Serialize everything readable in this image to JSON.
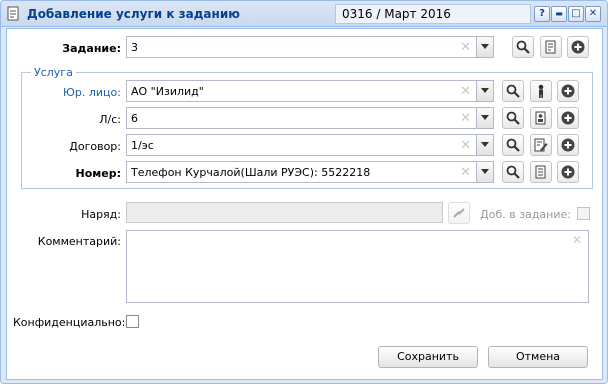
{
  "window": {
    "title": "Добавление услуги к заданию",
    "period": "0316 / Март 2016",
    "buttons": {
      "help": "?",
      "minimize": "▬",
      "maximize": "□",
      "close": "✕"
    }
  },
  "task": {
    "label": "Задание:",
    "value": "3"
  },
  "service_group": {
    "legend": "Услуга",
    "legal_entity": {
      "label": "Юр. лицо:",
      "value": "АО \"Изилид\""
    },
    "account": {
      "label": "Л/с:",
      "value": "6"
    },
    "contract": {
      "label": "Договор:",
      "value": "1/эс"
    },
    "number": {
      "label": "Номер:",
      "value": "Телефон Курчалой(Шали РУЭС): 5522218"
    }
  },
  "order": {
    "label": "Наряд:",
    "value": "",
    "add_label": "Доб. в задание:"
  },
  "comment": {
    "label": "Комментарий:",
    "value": ""
  },
  "confidential": {
    "label": "Конфиденциально:",
    "checked": false
  },
  "actions": {
    "save": "Сохранить",
    "cancel": "Отмена"
  }
}
